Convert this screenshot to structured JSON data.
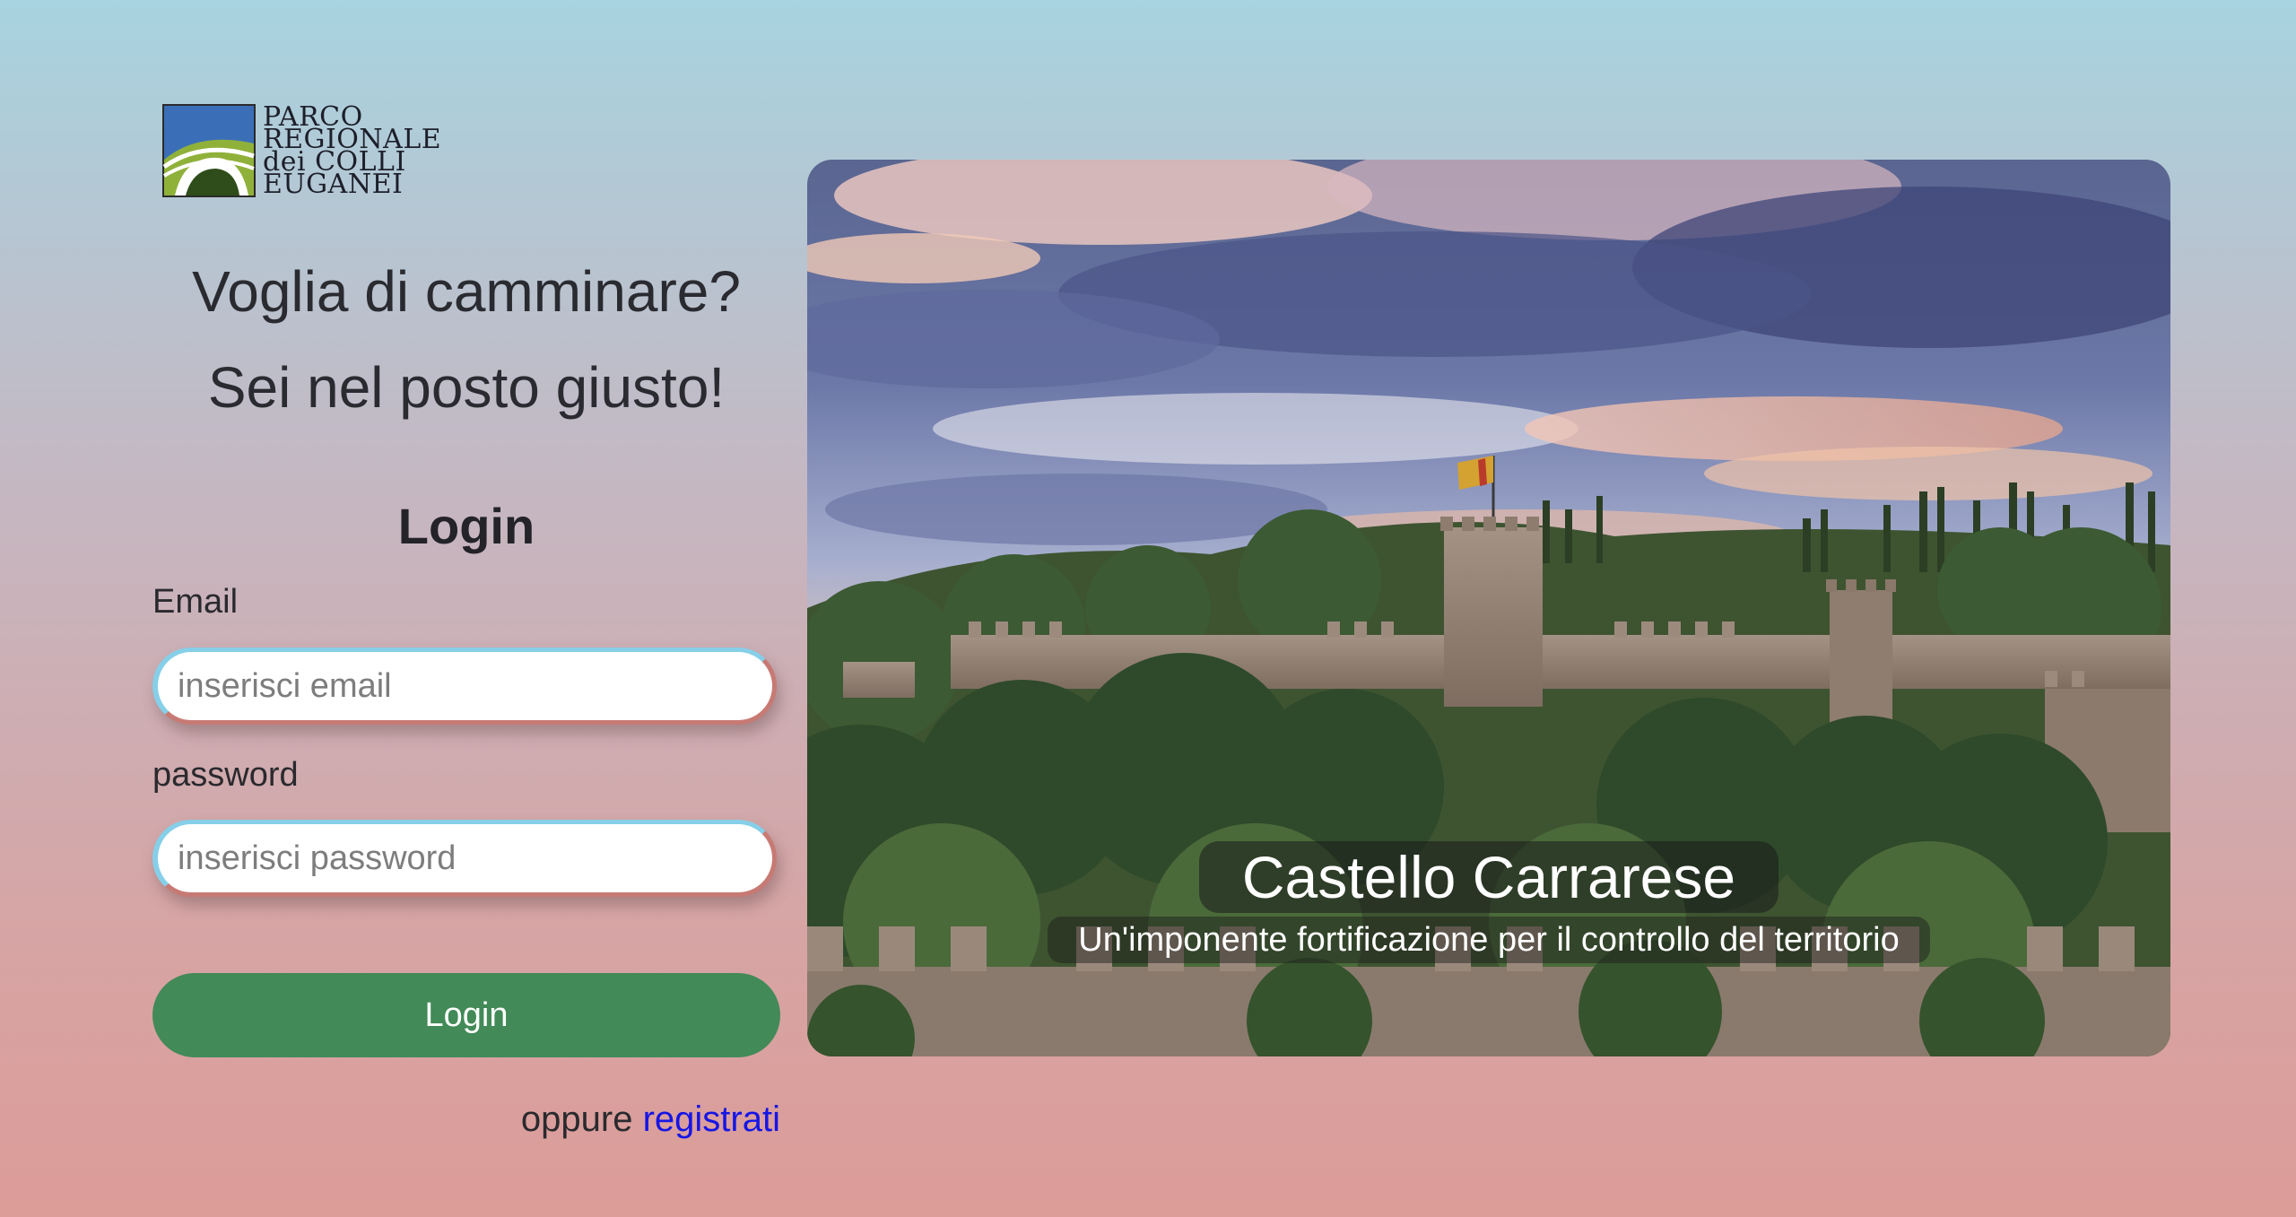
{
  "logo": {
    "lines": [
      "PARCO",
      "REGIONALE",
      "dei COLLI",
      "EUGANEI"
    ],
    "colors": {
      "sky": "#3a6fb7",
      "hill": "#7a9a2a",
      "frame": "#2b2b2b"
    }
  },
  "intro": {
    "line1": "Voglia di camminare?",
    "line2": "Sei nel posto giusto!"
  },
  "login_form": {
    "title": "Login",
    "email": {
      "label": "Email",
      "placeholder": "inserisci email",
      "value": ""
    },
    "password": {
      "label": "password",
      "placeholder": "inserisci password",
      "value": ""
    },
    "submit_label": "Login",
    "alt_prefix": "oppure",
    "register_link": "registrati"
  },
  "hero": {
    "image": "castle-landscape",
    "title": "Castello Carrarese",
    "subtitle": "Un'imponente fortificazione per il controllo del territorio"
  },
  "colors": {
    "background_top": "#a8d3e0",
    "background_bottom": "#dc9c98",
    "button": "#428a58",
    "link": "#1515e6",
    "input_border_light": "#86cfe8",
    "input_border_dark": "#c77a73"
  }
}
